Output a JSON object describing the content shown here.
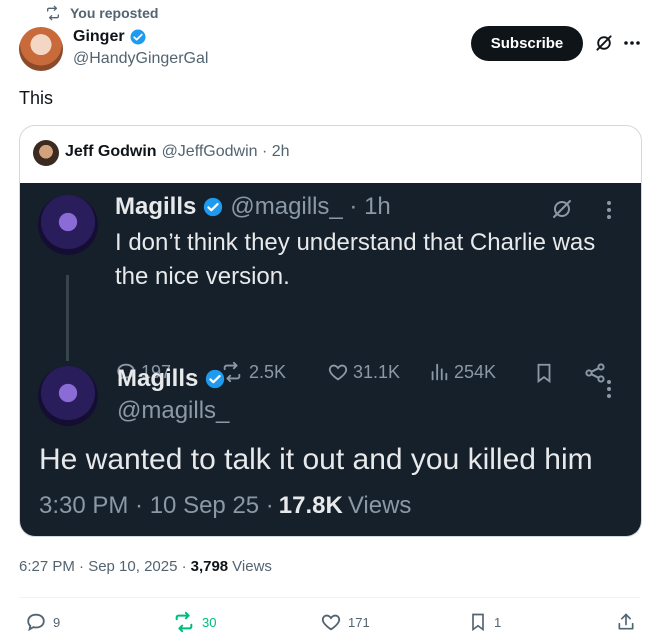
{
  "repost": {
    "label": "You reposted"
  },
  "author": {
    "name": "Ginger",
    "handle": "@HandyGingerGal"
  },
  "subscribe_label": "Subscribe",
  "post_text": "This",
  "quote": {
    "name": "Jeff Godwin",
    "handle_time": "@JeffGodwin · 2h",
    "screenshot": {
      "tweet1": {
        "name": "Magills",
        "handle_time": "@magills_ · 1h",
        "text": "I don’t think they understand that Charlie was the nice version.",
        "replies": "197",
        "reposts": "2.5K",
        "likes": "31.1K",
        "views": "254K"
      },
      "tweet2": {
        "name": "Magills",
        "handle": "@magills_",
        "text": "He wanted to talk it out and you killed him",
        "timestamp": "3:30 PM · 10 Sep 25 ·",
        "views_count": "17.8K",
        "views_label": "Views"
      }
    }
  },
  "post_meta": {
    "time": "6:27 PM · Sep 10, 2025 ·",
    "views_count": "3,798",
    "views_label": "Views"
  },
  "actions": {
    "replies": "9",
    "reposts": "30",
    "likes": "171",
    "bookmarks": "1"
  },
  "colors": {
    "verified": "#1d9bf0",
    "repost_green": "#00ba7c",
    "dark_bg": "#15202b"
  }
}
